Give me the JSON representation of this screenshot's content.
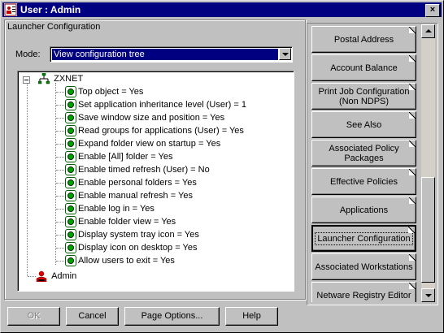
{
  "window": {
    "title": "User : Admin",
    "close_label": "×"
  },
  "group": {
    "label": "Launcher Configuration"
  },
  "mode": {
    "label": "Mode:",
    "value": "View configuration tree"
  },
  "tree": {
    "root": "ZXNET",
    "items": [
      "Top object = Yes",
      "Set application inheritance level (User) = 1",
      "Save window size and position = Yes",
      "Read groups for applications (User) = Yes",
      "Expand folder view on startup = Yes",
      "Enable [All] folder = Yes",
      "Enable timed refresh (User) = No",
      "Enable personal folders = Yes",
      "Enable manual refresh = Yes",
      "Enable log in = Yes",
      "Enable folder view = Yes",
      "Display system tray icon = Yes",
      "Display icon on desktop = Yes",
      "Allow users to exit = Yes"
    ],
    "user": "Admin"
  },
  "buttons": {
    "ok": "OK",
    "cancel": "Cancel",
    "page_options": "Page Options...",
    "help": "Help"
  },
  "tabs": [
    "Postal Address",
    "Account Balance",
    "Print Job Configuration (Non NDPS)",
    "See Also",
    "Associated Policy Packages",
    "Effective Policies",
    "Applications",
    "Launcher Configuration",
    "Associated Workstations",
    "Netware Registry Editor"
  ],
  "active_tab": "Launcher Configuration"
}
